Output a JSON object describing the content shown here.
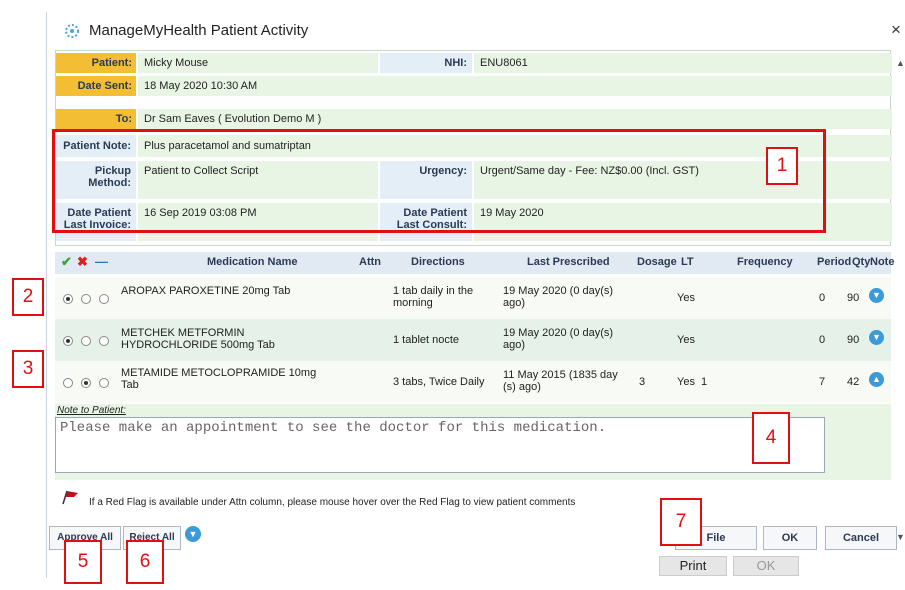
{
  "window": {
    "title": "ManageMyHealth Patient Activity",
    "close_label": "×"
  },
  "patient_info": {
    "patient_label": "Patient:",
    "patient_value": "Micky Mouse",
    "nhi_label": "NHI:",
    "nhi_value": "ENU8061",
    "date_sent_label": "Date Sent:",
    "date_sent_value": "18 May 2020 10:30 AM",
    "to_label": "To:",
    "to_value": "Dr Sam Eaves ( Evolution Demo M )",
    "note_label": "Patient Note:",
    "note_value": "Plus paracetamol and sumatriptan",
    "pickup_label_1": "Pickup",
    "pickup_label_2": "Method:",
    "pickup_value": "Patient to Collect Script",
    "urgency_label": "Urgency:",
    "urgency_value": "Urgent/Same day - Fee: NZ$0.00 (Incl. GST)",
    "last_invoice_label_1": "Date Patient",
    "last_invoice_label_2": "Last Invoice:",
    "last_invoice_value": "16 Sep 2019 03:08 PM",
    "last_consult_label_1": "Date Patient",
    "last_consult_label_2": "Last Consult:",
    "last_consult_value": "19 May 2020"
  },
  "grid": {
    "approve_icon": "✔",
    "reject_icon": "✖",
    "neutral_icon": "—",
    "columns": [
      "Medication Name",
      "Attn",
      "Directions",
      "Last Prescribed",
      "Dosage",
      "LT",
      "Frequency",
      "Period",
      "Qty",
      "Note"
    ],
    "rows": [
      {
        "selected": 0,
        "name_1": "AROPAX PAROXETINE 20mg Tab",
        "name_2": "",
        "directions_1": "1 tab daily in the",
        "directions_2": "morning",
        "last_1": "19 May 2020 (0 day(s)",
        "last_2": "ago)",
        "dosage": "",
        "lt": "Yes",
        "frequency": "",
        "period": "0",
        "qty": "90",
        "note_icon": "▼"
      },
      {
        "selected": 0,
        "name_1": "METCHEK METFORMIN",
        "name_2": "HYDROCHLORIDE 500mg Tab",
        "directions_1": "1 tablet nocte",
        "directions_2": "",
        "last_1": "19 May 2020 (0 day(s)",
        "last_2": "ago)",
        "dosage": "",
        "lt": "Yes",
        "frequency": "",
        "period": "0",
        "qty": "90",
        "note_icon": "▼"
      },
      {
        "selected": 1,
        "name_1": "METAMIDE METOCLOPRAMIDE 10mg",
        "name_2": "Tab",
        "directions_1": "3 tabs, Twice Daily",
        "directions_2": "",
        "last_1": "11 May 2015 (1835 day",
        "last_2": "(s) ago)",
        "dosage": "3",
        "lt": "Yes",
        "frequency": "1",
        "period": "7",
        "qty": "42",
        "note_icon": "▲"
      }
    ]
  },
  "note_to_patient": {
    "label": "Note to Patient:",
    "value": "Please make an appointment to see the doctor for this medication."
  },
  "red_flag_hint": "If a Red Flag is available under Attn column, please mouse hover over the Red Flag to view patient comments",
  "buttons": {
    "approve_all": "Approve All",
    "reject_all": "Reject All",
    "file": "File",
    "ok": "OK",
    "cancel": "Cancel",
    "print": "Print",
    "ok_disabled": "OK"
  },
  "callouts": [
    "1",
    "2",
    "3",
    "4",
    "5",
    "6",
    "7"
  ],
  "colors": {
    "label_orange": "#f3be34",
    "value_green": "#e9f5e4",
    "label_blue": "#e4eef7",
    "callout_red": "#e01010",
    "note_icon_blue": "#3a9bd8"
  }
}
